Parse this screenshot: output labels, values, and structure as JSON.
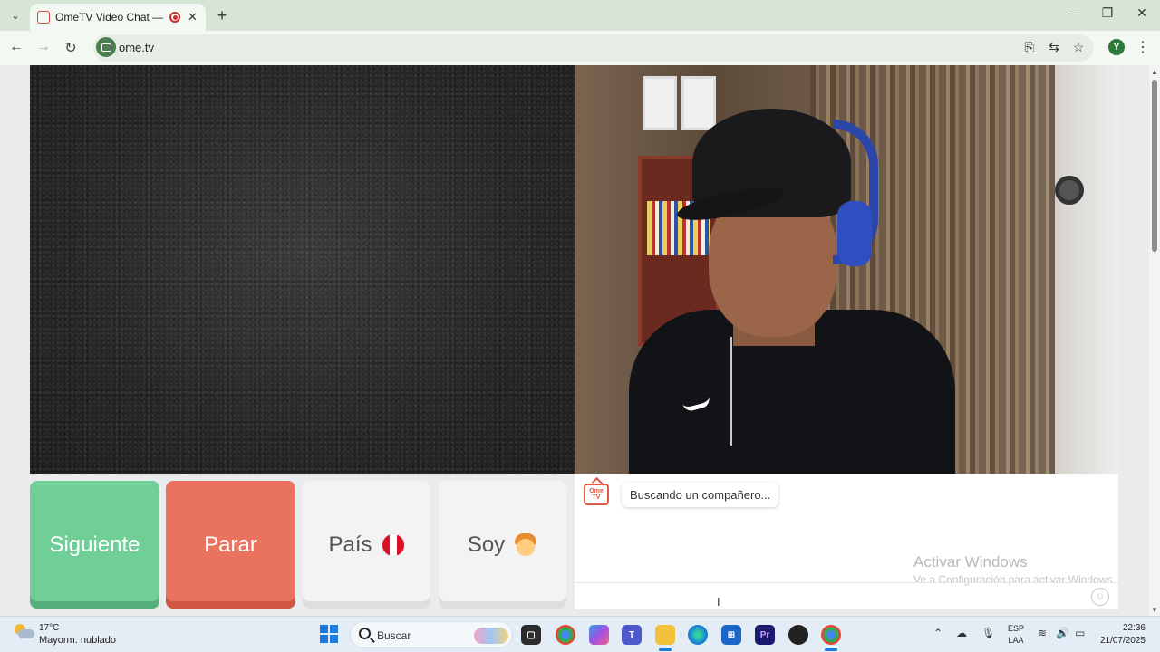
{
  "browser": {
    "tab_title": "OmeTV Video Chat — Omegle",
    "url": "ome.tv",
    "profile_initial": "Y"
  },
  "controls": {
    "next_label": "Siguiente",
    "stop_label": "Parar",
    "country_label": "País",
    "soy_label": "Soy"
  },
  "chat": {
    "logo_line1": "Ome",
    "logo_line2": "TV",
    "status_message": "Buscando un compañero...",
    "input_placeholder": ""
  },
  "watermark": {
    "title": "Activar Windows",
    "subtitle": "Ve a Configuración para activar Windows."
  },
  "taskbar": {
    "temperature": "17°C",
    "weather": "Mayorm. nublado",
    "search_placeholder": "Buscar",
    "language_line1": "ESP",
    "language_line2": "LAA",
    "time": "22:36",
    "date": "21/07/2025"
  },
  "colors": {
    "next_button": "#6fcf97",
    "stop_button": "#e9735e",
    "neutral_button": "#f3f3f3",
    "brand_red": "#e05a47"
  }
}
